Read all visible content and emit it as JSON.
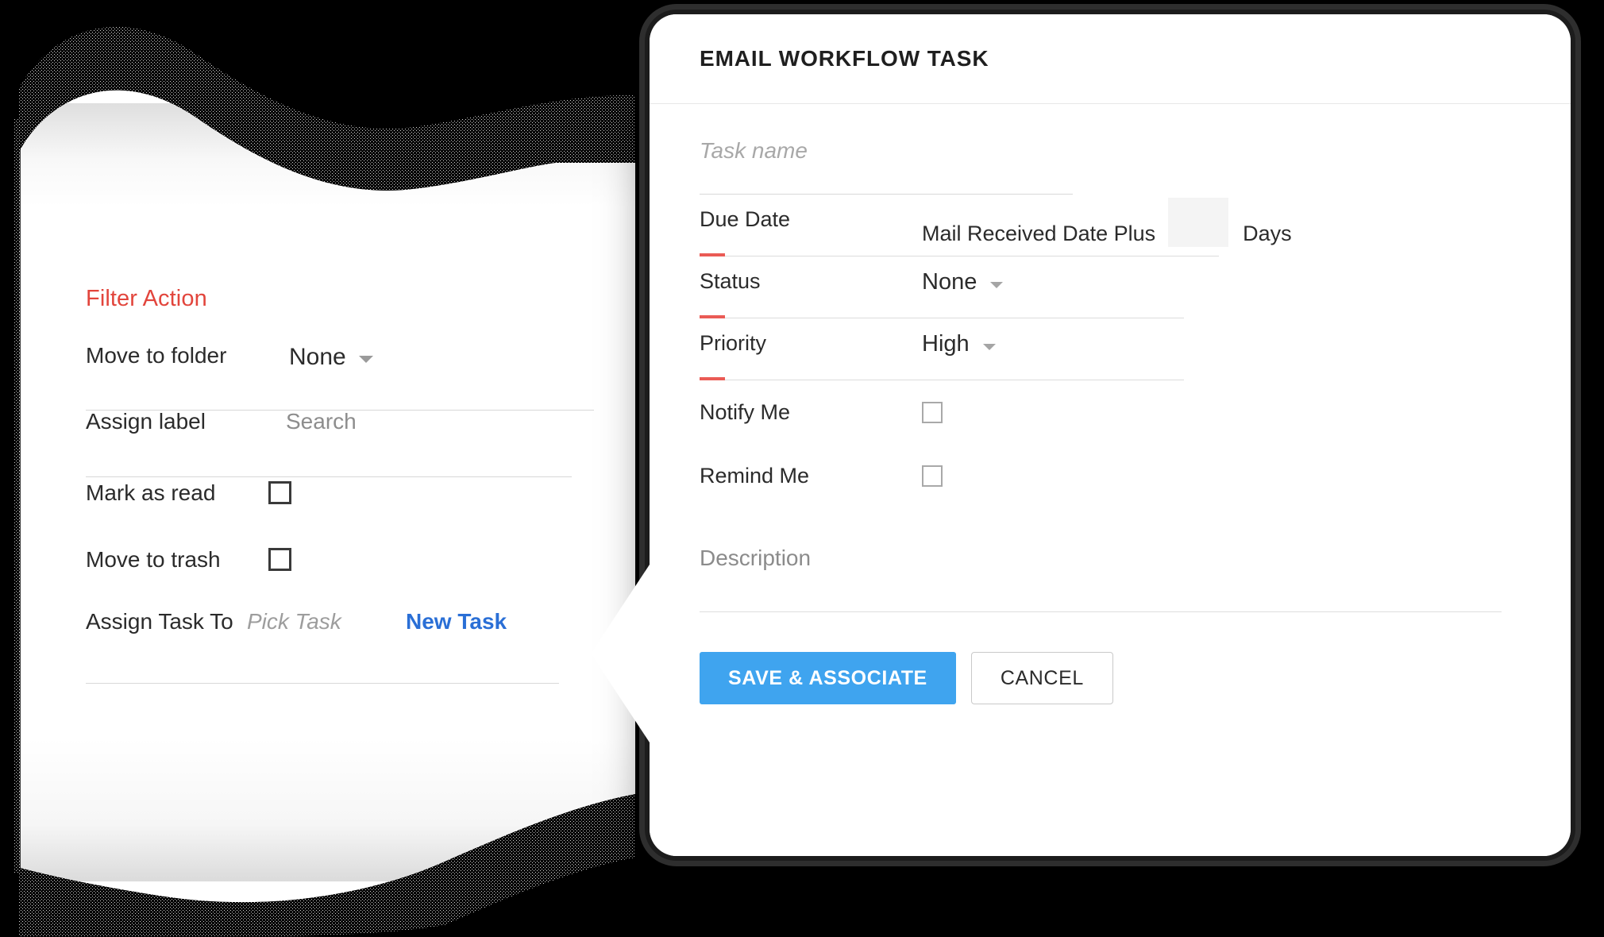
{
  "background_color": "#000000",
  "colors": {
    "accent_red": "#e2453c",
    "field_accent_red": "#ea5b55",
    "link_blue": "#2a6fd6",
    "primary_button_blue": "#3fa4ef",
    "rule_gray": "#d8d8d8",
    "placeholder_gray": "#8d8d8d"
  },
  "filter_panel": {
    "title": "Filter Action",
    "rows": [
      {
        "label": "Move to folder",
        "control": "dropdown",
        "value": "None",
        "icon": "chevron-down-icon"
      },
      {
        "label": "Assign label",
        "control": "search-input",
        "placeholder": "Search",
        "value": ""
      },
      {
        "label": "Mark as read",
        "control": "checkbox",
        "checked": false
      },
      {
        "label": "Move to trash",
        "control": "checkbox",
        "checked": false
      },
      {
        "label": "Assign Task To",
        "control": "picker",
        "placeholder": "Pick Task",
        "value": "",
        "action_link": "New Task"
      }
    ]
  },
  "modal": {
    "title": "EMAIL WORKFLOW TASK",
    "task_name": {
      "placeholder": "Task name",
      "value": ""
    },
    "due_date": {
      "label": "Due Date",
      "prefix_text": "Mail Received Date Plus",
      "days_value": "",
      "suffix_text": "Days"
    },
    "status": {
      "label": "Status",
      "value": "None",
      "icon": "chevron-down-icon"
    },
    "priority": {
      "label": "Priority",
      "value": "High",
      "icon": "chevron-down-icon"
    },
    "notify_me": {
      "label": "Notify Me",
      "checked": false
    },
    "remind_me": {
      "label": "Remind Me",
      "checked": false
    },
    "description": {
      "placeholder": "Description",
      "value": ""
    },
    "buttons": {
      "primary": "SAVE & ASSOCIATE",
      "secondary": "CANCEL"
    }
  }
}
